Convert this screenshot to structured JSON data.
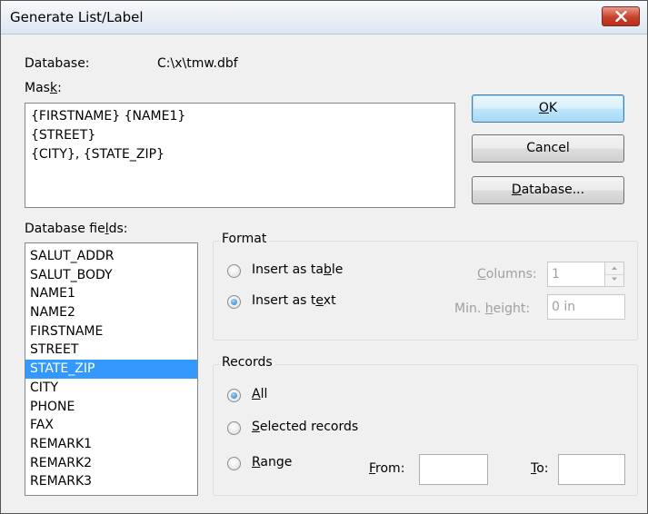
{
  "window": {
    "title": "Generate List/Label",
    "close_icon": "close-x-icon"
  },
  "database": {
    "label": "Database:",
    "path": "C:\\x\\tmw.dbf"
  },
  "mask": {
    "label_pre": "Mas",
    "label_key": "k",
    "label_post": ":",
    "lines": [
      "{FIRSTNAME} {NAME1}",
      "{STREET}",
      "{CITY}, {STATE_ZIP}"
    ]
  },
  "buttons": {
    "ok": {
      "key": "O",
      "rest": "K"
    },
    "cancel": "Cancel",
    "database": {
      "key": "D",
      "rest": "atabase..."
    }
  },
  "fields": {
    "label_pre": "Database fie",
    "label_key": "l",
    "label_post": "ds:",
    "items": [
      "SALUT_ADDR",
      "SALUT_BODY",
      "NAME1",
      "NAME2",
      "FIRSTNAME",
      "STREET",
      "STATE_ZIP",
      "CITY",
      "PHONE",
      "FAX",
      "REMARK1",
      "REMARK2",
      "REMARK3"
    ],
    "selected": "STATE_ZIP"
  },
  "format": {
    "title": "Format",
    "insert_table": {
      "pre": "Insert as ta",
      "key": "b",
      "post": "le",
      "checked": false
    },
    "insert_text": {
      "pre": "Insert as t",
      "key": "e",
      "post": "xt",
      "checked": true
    },
    "columns": {
      "key": "C",
      "rest": "olumns:",
      "value": "1"
    },
    "min_height": {
      "pre": "Min. ",
      "key": "h",
      "post": "eight:",
      "value": "0 in"
    }
  },
  "records": {
    "title": "Records",
    "all": {
      "key": "A",
      "rest": "ll",
      "checked": true
    },
    "selected": {
      "key": "S",
      "rest": "elected records",
      "checked": false
    },
    "range": {
      "key": "R",
      "rest": "ange",
      "checked": false
    },
    "from": {
      "key": "F",
      "rest": "rom:",
      "value": ""
    },
    "to": {
      "key": "T",
      "rest": "o:",
      "value": ""
    }
  },
  "colors": {
    "selection": "#3399ff",
    "close_button": "#c7412b",
    "default_button": "#3c7fb1"
  }
}
